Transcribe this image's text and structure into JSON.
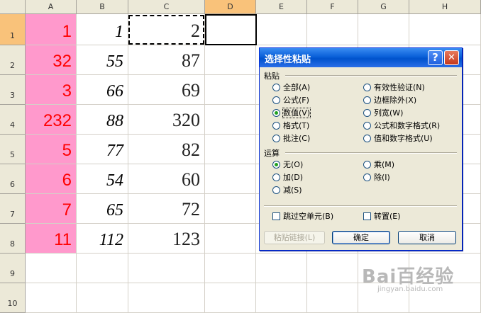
{
  "sheet": {
    "columns": [
      "A",
      "B",
      "C",
      "D",
      "E",
      "F",
      "G",
      "H"
    ],
    "rows": [
      "1",
      "2",
      "3",
      "4",
      "5",
      "6",
      "7",
      "8",
      "9",
      "10"
    ],
    "colA": [
      "1",
      "32",
      "3",
      "232",
      "5",
      "6",
      "7",
      "11"
    ],
    "colB": [
      "1",
      "55",
      "66",
      "88",
      "77",
      "54",
      "65",
      "112"
    ],
    "colC": [
      "2",
      "87",
      "69",
      "320",
      "82",
      "60",
      "72",
      "123"
    ]
  },
  "dialog": {
    "title": "选择性粘贴",
    "help_label": "?",
    "close_label": "✕",
    "paste_group": "粘贴",
    "paste_options": [
      "全部(A)",
      "有效性验证(N)",
      "公式(F)",
      "边框除外(X)",
      "数值(V)",
      "列宽(W)",
      "格式(T)",
      "公式和数字格式(R)",
      "批注(C)",
      "值和数字格式(U)"
    ],
    "paste_selected": "数值(V)",
    "operation_group": "运算",
    "operation_options": [
      "无(O)",
      "乘(M)",
      "加(D)",
      "除(I)",
      "减(S)"
    ],
    "operation_selected": "无(O)",
    "skip_blanks": "跳过空单元(B)",
    "transpose": "转置(E)",
    "paste_link": "粘贴链接(L)",
    "ok": "确定",
    "cancel": "取消"
  },
  "watermark": {
    "brand": "Bai百经验",
    "url": "jingyan.baidu.com"
  }
}
